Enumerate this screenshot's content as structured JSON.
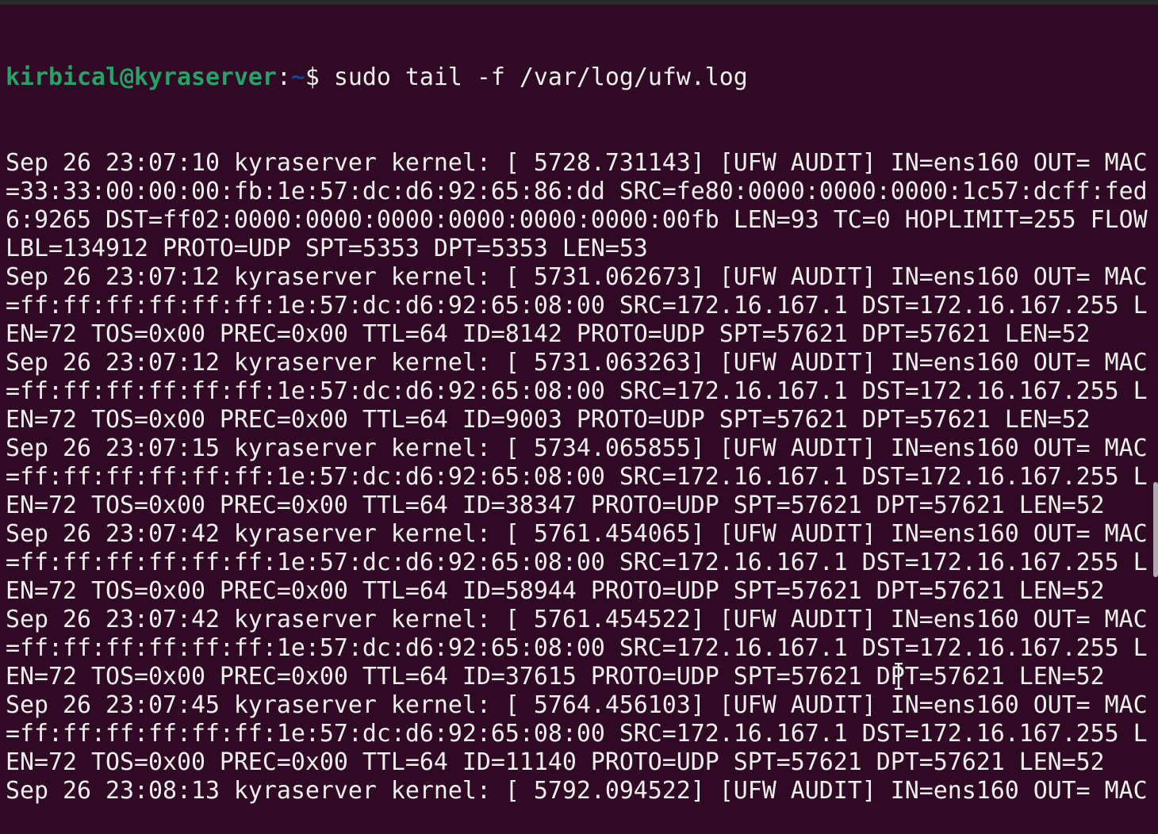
{
  "prompt": {
    "user_host": "kirbical@kyraserver",
    "separator": ":",
    "path": "~",
    "symbol": "$ ",
    "command": "sudo tail -f /var/log/ufw.log"
  },
  "colors": {
    "background": "#300a24",
    "prompt_user": "#26a269",
    "prompt_path": "#12488b",
    "text": "#eeeeec"
  },
  "output_lines": [
    "Sep 26 23:07:10 kyraserver kernel: [ 5728.731143] [UFW AUDIT] IN=ens160 OUT= MAC",
    "=33:33:00:00:00:fb:1e:57:dc:d6:92:65:86:dd SRC=fe80:0000:0000:0000:1c57:dcff:fed",
    "6:9265 DST=ff02:0000:0000:0000:0000:0000:0000:00fb LEN=93 TC=0 HOPLIMIT=255 FLOW",
    "LBL=134912 PROTO=UDP SPT=5353 DPT=5353 LEN=53",
    "Sep 26 23:07:12 kyraserver kernel: [ 5731.062673] [UFW AUDIT] IN=ens160 OUT= MAC",
    "=ff:ff:ff:ff:ff:ff:1e:57:dc:d6:92:65:08:00 SRC=172.16.167.1 DST=172.16.167.255 L",
    "EN=72 TOS=0x00 PREC=0x00 TTL=64 ID=8142 PROTO=UDP SPT=57621 DPT=57621 LEN=52",
    "Sep 26 23:07:12 kyraserver kernel: [ 5731.063263] [UFW AUDIT] IN=ens160 OUT= MAC",
    "=ff:ff:ff:ff:ff:ff:1e:57:dc:d6:92:65:08:00 SRC=172.16.167.1 DST=172.16.167.255 L",
    "EN=72 TOS=0x00 PREC=0x00 TTL=64 ID=9003 PROTO=UDP SPT=57621 DPT=57621 LEN=52",
    "Sep 26 23:07:15 kyraserver kernel: [ 5734.065855] [UFW AUDIT] IN=ens160 OUT= MAC",
    "=ff:ff:ff:ff:ff:ff:1e:57:dc:d6:92:65:08:00 SRC=172.16.167.1 DST=172.16.167.255 L",
    "EN=72 TOS=0x00 PREC=0x00 TTL=64 ID=38347 PROTO=UDP SPT=57621 DPT=57621 LEN=52",
    "Sep 26 23:07:42 kyraserver kernel: [ 5761.454065] [UFW AUDIT] IN=ens160 OUT= MAC",
    "=ff:ff:ff:ff:ff:ff:1e:57:dc:d6:92:65:08:00 SRC=172.16.167.1 DST=172.16.167.255 L",
    "EN=72 TOS=0x00 PREC=0x00 TTL=64 ID=58944 PROTO=UDP SPT=57621 DPT=57621 LEN=52",
    "Sep 26 23:07:42 kyraserver kernel: [ 5761.454522] [UFW AUDIT] IN=ens160 OUT= MAC",
    "=ff:ff:ff:ff:ff:ff:1e:57:dc:d6:92:65:08:00 SRC=172.16.167.1 DST=172.16.167.255 L",
    "EN=72 TOS=0x00 PREC=0x00 TTL=64 ID=37615 PROTO=UDP SPT=57621 DPT=57621 LEN=52",
    "Sep 26 23:07:45 kyraserver kernel: [ 5764.456103] [UFW AUDIT] IN=ens160 OUT= MAC",
    "=ff:ff:ff:ff:ff:ff:1e:57:dc:d6:92:65:08:00 SRC=172.16.167.1 DST=172.16.167.255 L",
    "EN=72 TOS=0x00 PREC=0x00 TTL=64 ID=11140 PROTO=UDP SPT=57621 DPT=57621 LEN=52",
    "Sep 26 23:08:13 kyraserver kernel: [ 5792.094522] [UFW AUDIT] IN=ens160 OUT= MAC"
  ]
}
